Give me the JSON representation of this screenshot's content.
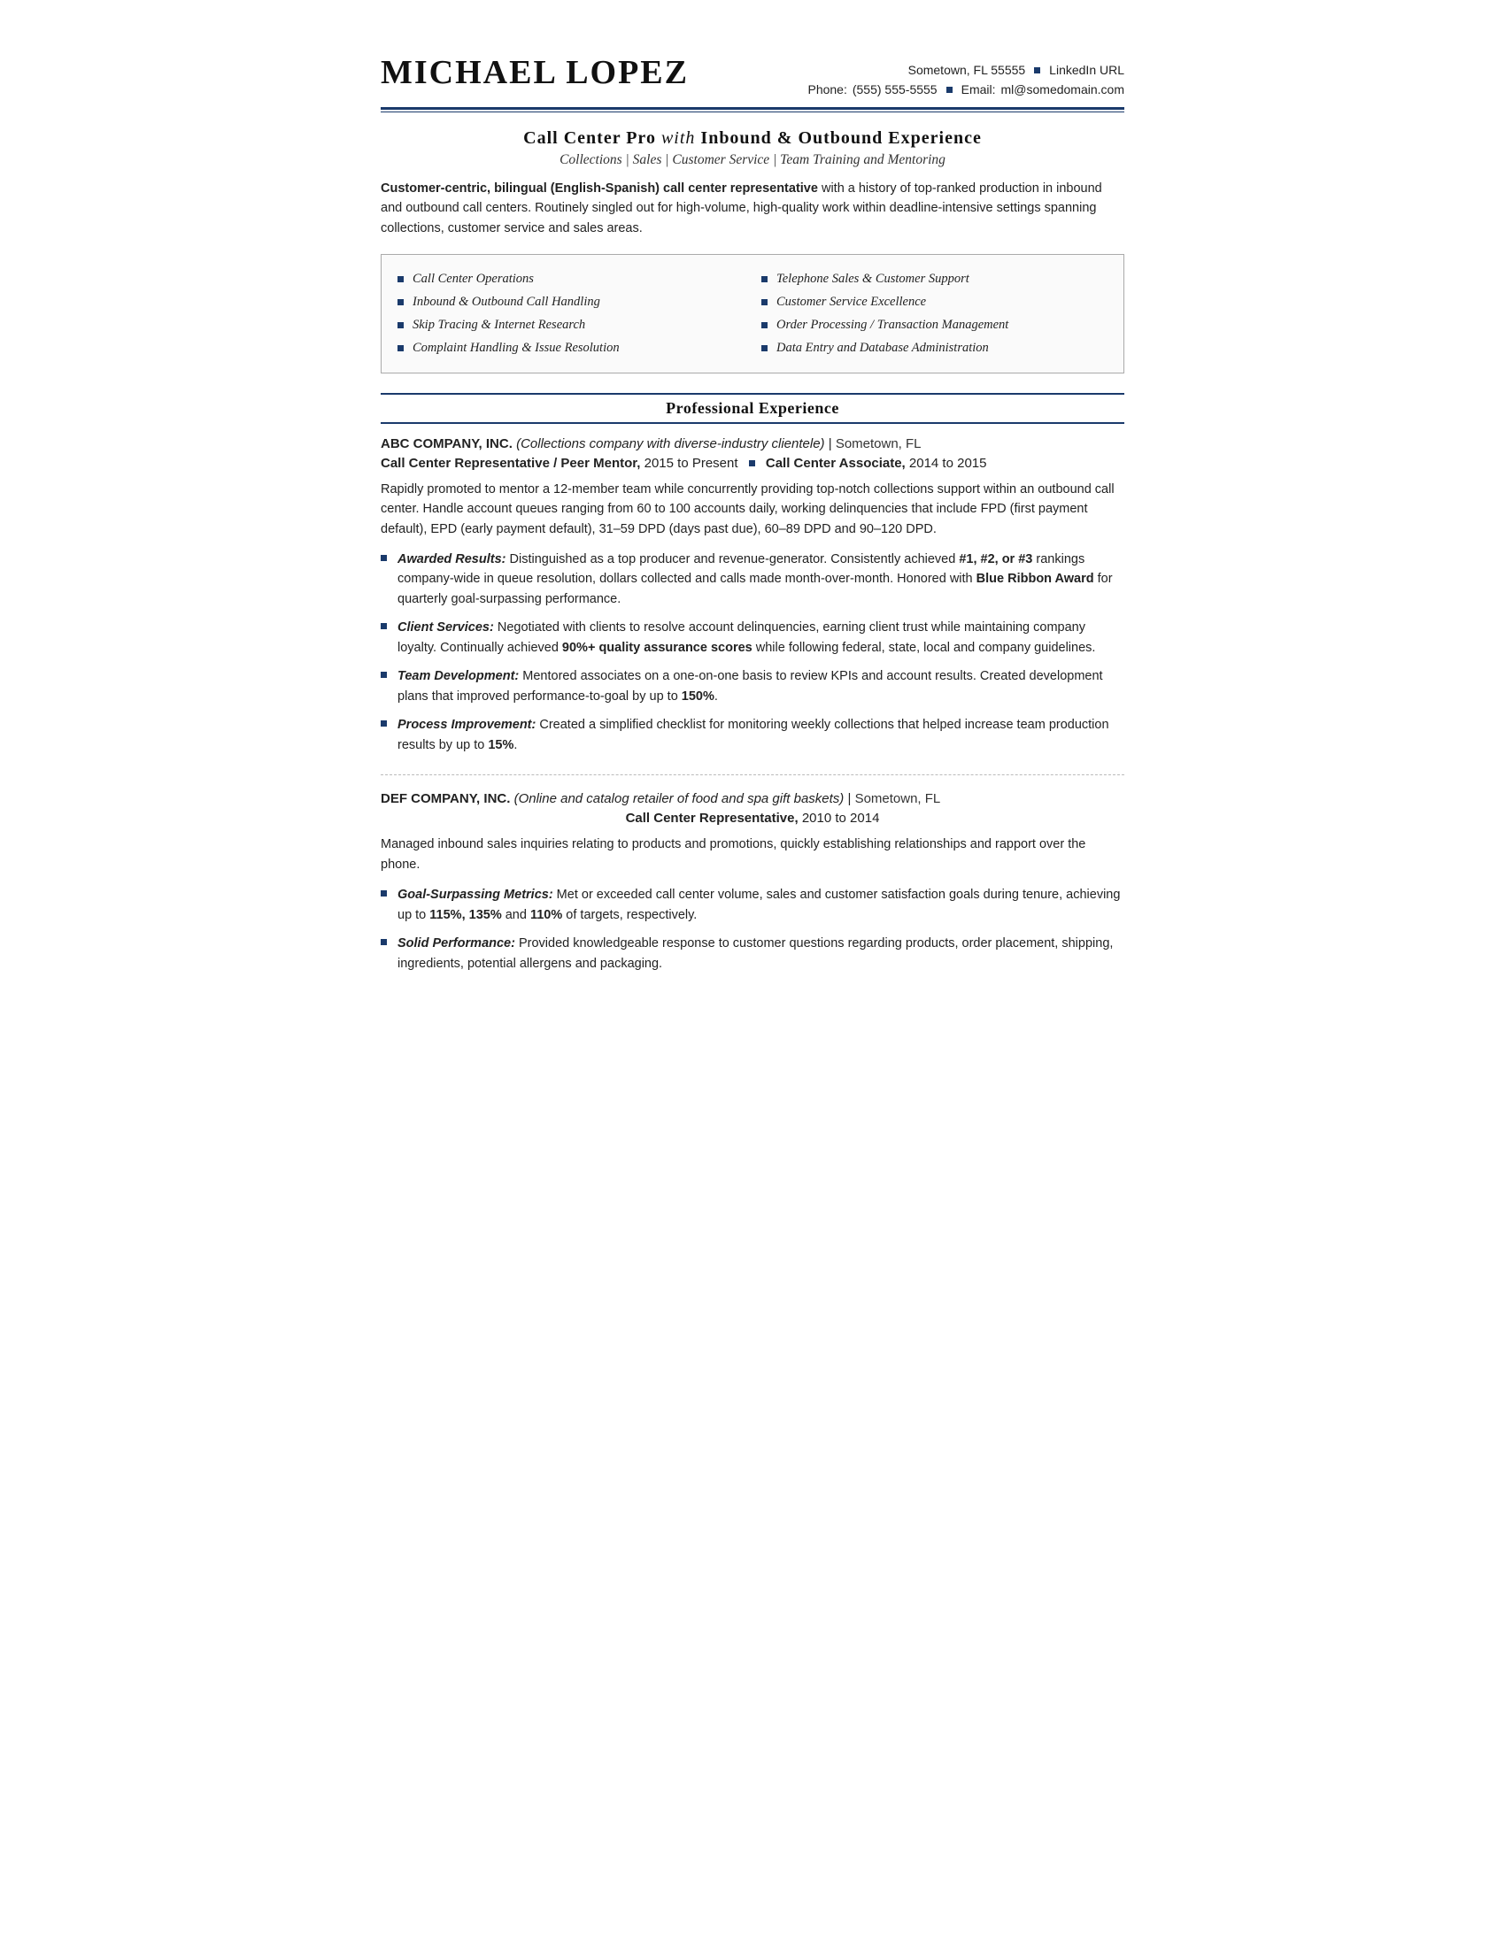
{
  "header": {
    "name": "Michael Lopez",
    "contact": {
      "line1": "Sometown, FL 55555",
      "linkedin": "LinkedIn URL",
      "phone_label": "Phone:",
      "phone": "(555) 555-5555",
      "email_label": "Email:",
      "email": "ml@somedomain.com"
    }
  },
  "title_section": {
    "main_title_1": "Call Center Pro",
    "main_title_italic": "with",
    "main_title_2": "Inbound & Outbound Experience",
    "subtitle": "Collections | Sales | Customer Service | Team Training and Mentoring"
  },
  "summary": {
    "bold_part": "Customer-centric, bilingual (English-Spanish) call center representative",
    "rest": " with a history of top-ranked production in inbound and outbound call centers. Routinely singled out for high-volume, high-quality work within deadline-intensive settings spanning collections, customer service and sales areas."
  },
  "skills": {
    "left": [
      "Call Center Operations",
      "Inbound & Outbound Call Handling",
      "Skip Tracing & Internet Research",
      "Complaint Handling & Issue Resolution"
    ],
    "right": [
      "Telephone Sales & Customer Support",
      "Customer Service Excellence",
      "Order Processing / Transaction Management",
      "Data Entry and Database Administration"
    ]
  },
  "sections": {
    "professional_experience": "Professional Experience"
  },
  "jobs": [
    {
      "company": "ABC COMPANY, INC.",
      "company_desc": "(Collections company with diverse-industry clientele)",
      "location": "Sometown, FL",
      "title_line": {
        "title1_bold": "Call Center Representative / Peer Mentor,",
        "title1_dates": "2015 to Present",
        "title2_bold": "Call Center Associate,",
        "title2_dates": "2014 to 2015"
      },
      "body": "Rapidly promoted to mentor a 12-member team while concurrently providing top-notch collections support within an outbound call center. Handle account queues ranging from 60 to 100 accounts daily, working delinquencies that include FPD (first payment default), EPD (early payment default), 31–59 DPD (days past due), 60–89 DPD and 90–120 DPD.",
      "bullets": [
        {
          "bold_label": "Awarded Results:",
          "text": " Distinguished as a top producer and revenue-generator. Consistently achieved ",
          "bold_inline": "#1, #2, or #3",
          "text2": " rankings company-wide in queue resolution, dollars collected and calls made month-over-month. Honored with ",
          "bold_inline2": "Blue Ribbon Award",
          "text3": " for quarterly goal-surpassing performance."
        },
        {
          "bold_label": "Client Services:",
          "text": " Negotiated with clients to resolve account delinquencies, earning client trust while maintaining company loyalty. Continually achieved ",
          "bold_inline": "90%+ quality assurance scores",
          "text2": " while following federal, state, local and company guidelines.",
          "text3": ""
        },
        {
          "bold_label": "Team Development:",
          "text": " Mentored associates on a one-on-one basis to review KPIs and account results. Created development plans that improved performance-to-goal by up to ",
          "bold_inline": "150%",
          "text2": ".",
          "text3": ""
        },
        {
          "bold_label": "Process Improvement:",
          "text": " Created a simplified checklist for monitoring weekly collections that helped increase team production results by up to ",
          "bold_inline": "15%",
          "text2": ".",
          "text3": ""
        }
      ]
    },
    {
      "company": "DEF COMPANY, INC.",
      "company_desc": "(Online and catalog retailer of food and spa gift baskets)",
      "location": "Sometown, FL",
      "title_line": {
        "title1_bold": "Call Center Representative,",
        "title1_dates": "2010 to 2014",
        "title2_bold": "",
        "title2_dates": ""
      },
      "body": "Managed inbound sales inquiries relating to products and promotions, quickly establishing relationships and rapport over the phone.",
      "bullets": [
        {
          "bold_label": "Goal-Surpassing Metrics:",
          "text": " Met or exceeded call center volume, sales and customer satisfaction goals during tenure, achieving up to ",
          "bold_inline": "115%, 135%",
          "text2": " and ",
          "bold_inline2": "110%",
          "text3": " of targets, respectively."
        },
        {
          "bold_label": "Solid Performance:",
          "text": " Provided knowledgeable response to customer questions regarding products, order placement, shipping, ingredients, potential allergens and packaging.",
          "bold_inline": "",
          "text2": "",
          "text3": ""
        }
      ]
    }
  ]
}
